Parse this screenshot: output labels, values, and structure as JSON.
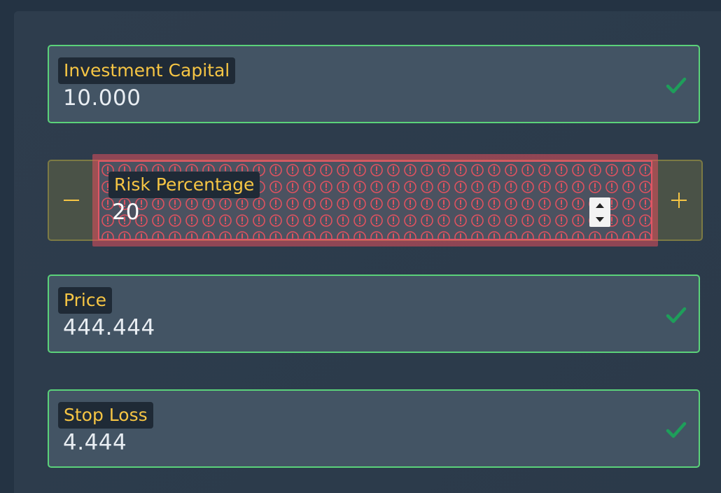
{
  "fields": {
    "investment_capital": {
      "label": "Investment Capital",
      "value": "10.000",
      "icon": "check-icon"
    },
    "risk_percentage": {
      "label": "Risk Percentage",
      "value": "20",
      "icon": "error-pattern"
    },
    "price": {
      "label": "Price",
      "value": "444.444",
      "icon": "check-icon"
    },
    "stop_loss": {
      "label": "Stop Loss",
      "value": "4.444",
      "icon": "check-icon"
    }
  },
  "stepper": {
    "minus_symbol": "−",
    "plus_symbol": "+"
  },
  "colors": {
    "valid_border": "#5bd27a",
    "check": "#1e9e5a",
    "label_text": "#f6c544",
    "error": "#e05766",
    "stepper_border": "#7c7a44"
  }
}
